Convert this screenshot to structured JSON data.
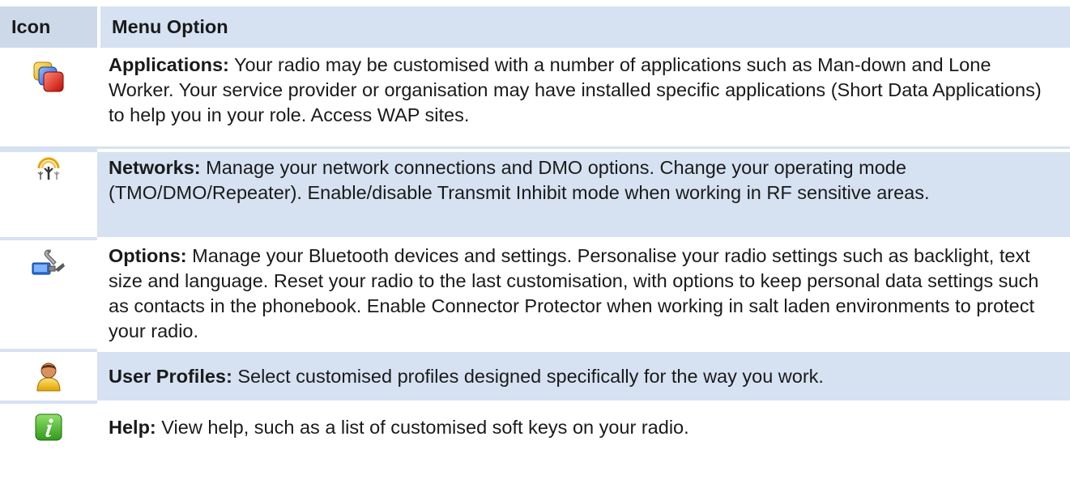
{
  "table": {
    "header": {
      "icon_col": "Icon",
      "option_col": "Menu Option"
    },
    "rows": [
      {
        "icon": "applications-icon",
        "title": "Applications:",
        "text": " Your radio may be customised with a number of applications such as Man-down and Lone Worker. Your service provider or organisation may have installed specific applications (Short Data Applications) to help you in your role. Access WAP sites."
      },
      {
        "icon": "networks-icon",
        "title": "Networks:",
        "text": " Manage your network connections and DMO options. Change your operating mode (TMO/DMO/Repeater). Enable/disable Transmit Inhibit mode when working in RF sensitive areas."
      },
      {
        "icon": "options-icon",
        "title": "Options:",
        "text": " Manage your Bluetooth devices and settings. Personalise your radio settings such as backlight, text size and language. Reset your radio to the last customisation, with options to keep personal data settings such as contacts in the phonebook. Enable Connector Protector when working in salt laden environments to protect your radio."
      },
      {
        "icon": "user-profiles-icon",
        "title": "User Profiles:",
        "text": " Select customised profiles designed specifically for the way you work."
      },
      {
        "icon": "help-icon",
        "title": "Help:",
        "text": " View help, such as a list of customised soft keys on your radio."
      }
    ]
  },
  "colors": {
    "header_bg": "#d6e2f2",
    "stripe_bg": "#d6e2f2",
    "text": "#1a1a1a"
  }
}
